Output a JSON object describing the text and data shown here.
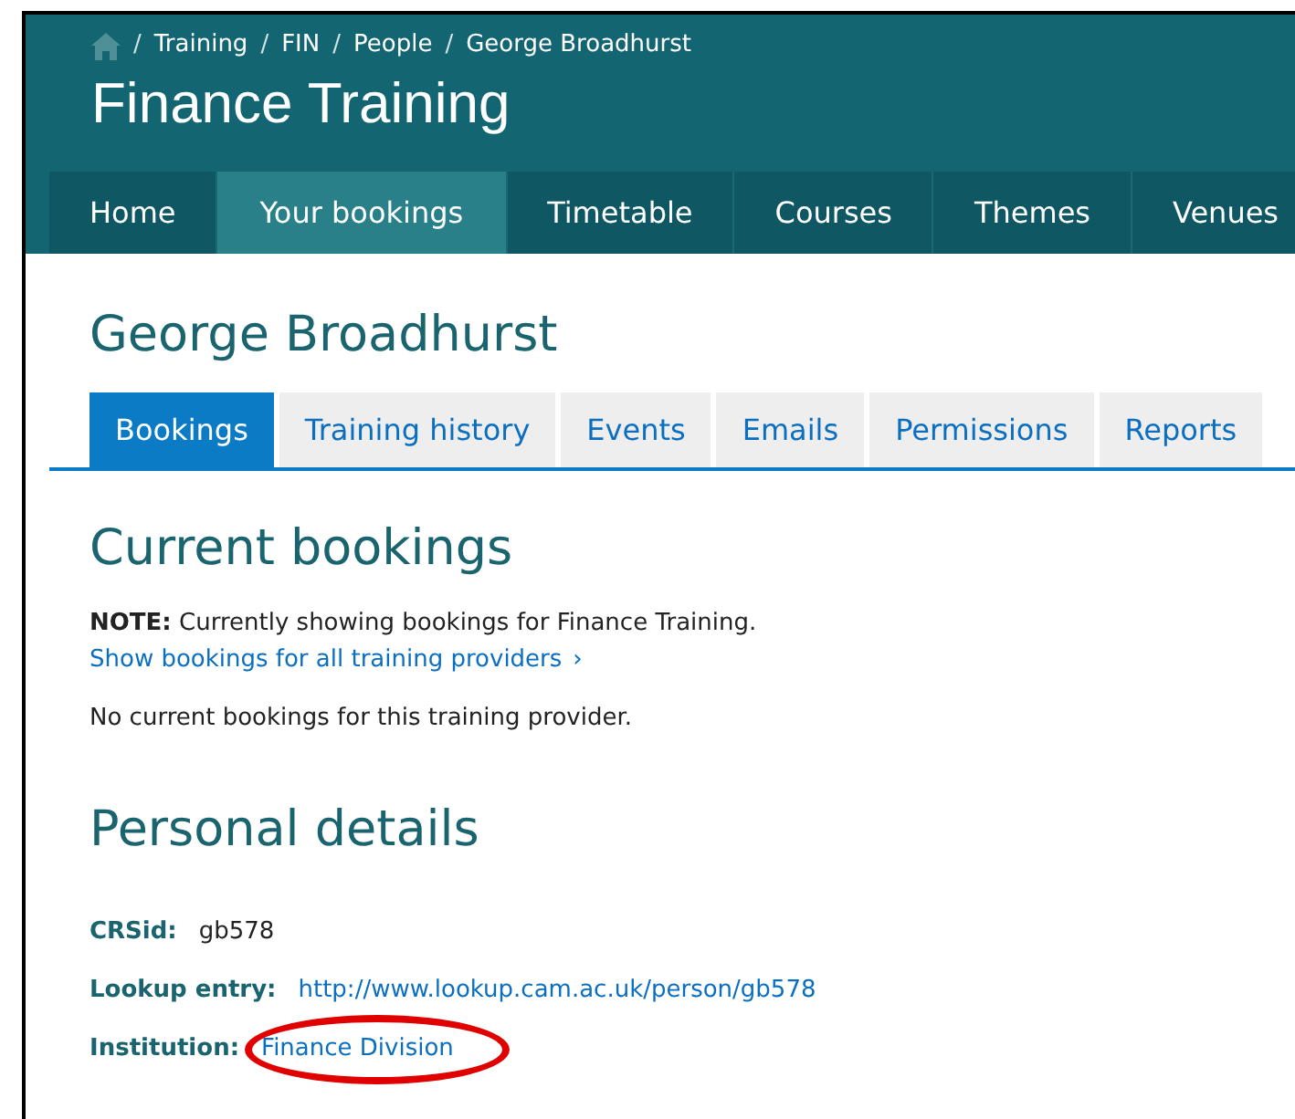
{
  "breadcrumb_separator": "/",
  "breadcrumb": [
    "Training",
    "FIN",
    "People",
    "George Broadhurst"
  ],
  "site_title": "Finance Training",
  "nav": [
    {
      "label": "Home",
      "selected": false
    },
    {
      "label": "Your bookings",
      "selected": true
    },
    {
      "label": "Timetable",
      "selected": false
    },
    {
      "label": "Courses",
      "selected": false
    },
    {
      "label": "Themes",
      "selected": false
    },
    {
      "label": "Venues",
      "selected": false
    }
  ],
  "person_name": "George Broadhurst",
  "tabs": [
    {
      "label": "Bookings",
      "selected": true
    },
    {
      "label": "Training history",
      "selected": false
    },
    {
      "label": "Events",
      "selected": false
    },
    {
      "label": "Emails",
      "selected": false
    },
    {
      "label": "Permissions",
      "selected": false
    },
    {
      "label": "Reports",
      "selected": false
    }
  ],
  "current_bookings": {
    "heading": "Current bookings",
    "note_label": "NOTE:",
    "note": "Currently showing bookings for Finance Training.",
    "link": "Show bookings for all training providers",
    "link_icon": "›",
    "empty": "No current bookings for this training provider."
  },
  "personal_details": {
    "heading": "Personal details",
    "fields": [
      {
        "label": "CRSid:",
        "value": "gb578",
        "kind": "text"
      },
      {
        "label": "Lookup entry:",
        "value": "http://www.lookup.cam.ac.uk/person/gb578",
        "kind": "link"
      },
      {
        "label": "Institution:",
        "value": "Finance Division",
        "kind": "link",
        "highlighted": true
      }
    ]
  }
}
